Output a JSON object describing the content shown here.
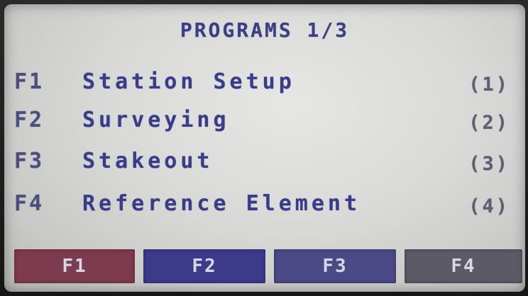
{
  "title": "PROGRAMS 1/3",
  "menu": {
    "items": [
      {
        "key": "F1",
        "label": "Station Setup",
        "index": "(1)"
      },
      {
        "key": "F2",
        "label": "Surveying",
        "index": "(2)"
      },
      {
        "key": "F3",
        "label": "Stakeout",
        "index": "(3)"
      },
      {
        "key": "F4",
        "label": "Reference Element",
        "index": "(4)"
      }
    ]
  },
  "softkeys": [
    {
      "label": "F1",
      "color": "#7d3b4f"
    },
    {
      "label": "F2",
      "color": "#3d3a8c"
    },
    {
      "label": "F3",
      "color": "#4c4a86"
    },
    {
      "label": "F4",
      "color": "#5b5a66"
    }
  ],
  "colors": {
    "text": "#3a3f86",
    "screen": "#dcdcda"
  }
}
